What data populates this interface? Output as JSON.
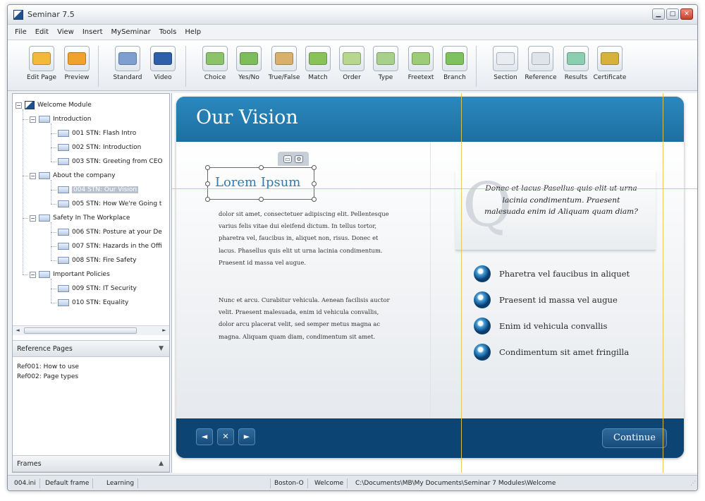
{
  "window": {
    "title": "Seminar 7.5"
  },
  "menu": [
    "File",
    "Edit",
    "View",
    "Insert",
    "MySeminar",
    "Tools",
    "Help"
  ],
  "toolbar": [
    {
      "label": "Edit Page",
      "icon": "edit-page-icon",
      "color": "#f2b93b"
    },
    {
      "label": "Preview",
      "icon": "preview-icon",
      "color": "#f0a32c"
    },
    {
      "label": "Standard",
      "icon": "standard-page-icon",
      "color": "#7f9fd0"
    },
    {
      "label": "Video",
      "icon": "video-icon",
      "color": "#2f5fa8"
    },
    {
      "label": "Choice",
      "icon": "choice-icon",
      "color": "#8cc36a"
    },
    {
      "label": "Yes/No",
      "icon": "yes-no-icon",
      "color": "#7dbd5c"
    },
    {
      "label": "True/False",
      "icon": "true-false-icon",
      "color": "#d9b06b"
    },
    {
      "label": "Match",
      "icon": "match-icon",
      "color": "#8ac25a"
    },
    {
      "label": "Order",
      "icon": "order-icon",
      "color": "#b9d68f"
    },
    {
      "label": "Type",
      "icon": "type-icon",
      "color": "#a9d08a"
    },
    {
      "label": "Freetext",
      "icon": "freetext-icon",
      "color": "#9ccc78"
    },
    {
      "label": "Branch",
      "icon": "branch-icon",
      "color": "#7fc15e"
    },
    {
      "label": "Section",
      "icon": "section-icon",
      "color": "#e9edf1"
    },
    {
      "label": "Reference",
      "icon": "reference-icon",
      "color": "#dfe4ea"
    },
    {
      "label": "Results",
      "icon": "results-icon",
      "color": "#8ccfb0"
    },
    {
      "label": "Certificate",
      "icon": "certificate-icon",
      "color": "#d7b23a"
    }
  ],
  "tree": {
    "root": "Welcome Module",
    "groups": [
      {
        "label": "Introduction",
        "items": [
          "001 STN: Flash Intro",
          "002 STN: Introduction",
          "003 STN: Greeting from CEO"
        ]
      },
      {
        "label": "About the company",
        "items": [
          "004 STN: Our Vision",
          "005 STN: How We're Going t"
        ]
      },
      {
        "label": "Safety In The Workplace",
        "items": [
          "006 STN: Posture at your De",
          "007 STN: Hazards in the Offi",
          "008 STN: Fire Safety"
        ]
      },
      {
        "label": "Important Policies",
        "items": [
          "009 STN: IT Security",
          "010 STN: Equality"
        ]
      }
    ],
    "selected": "004 STN: Our Vision"
  },
  "reference_pages": {
    "header": "Reference Pages",
    "items": [
      "Ref001: How to use",
      "Ref002: Page types"
    ]
  },
  "frames": {
    "header": "Frames"
  },
  "slide": {
    "title": "Our Vision",
    "heading": "Lorem Ipsum",
    "paragraph1": "dolor sit amet, consectetuer adipiscing elit. Pellentesque varius felis vitae dui eleifend dictum. In tellus tortor, pharetra vel, faucibus in, aliquet non, risus. Donec et lacus. Phasellus quis elit ut urna lacinia condimentum. Praesent id massa vel augue.",
    "paragraph2": "Nunc et arcu. Curabitur vehicula. Aenean facilisis auctor velit. Praesent malesuada, enim id vehicula convallis, dolor arcu placerat velit, sed semper metus magna ac magna. Aliquam quam diam, condimentum sit amet.",
    "quote": "Donec et lacus Pasellus quis elit ut urna lacinia condimentum. Praesent malesuada enim id Aliquam quam diam?",
    "quote_mark": "Q",
    "bullets": [
      "Pharetra vel faucibus in aliquet",
      "Praesent id massa vel augue",
      "Enim id vehicula convallis",
      "Condimentum sit amet fringilla"
    ],
    "nav": {
      "prev": "◄",
      "close": "✕",
      "next": "►"
    },
    "continue_label": "Continue"
  },
  "status": [
    "004.ini",
    "Default frame",
    "Learning",
    "Boston-O",
    "Welcome",
    "C:\\Documents\\MB\\My Documents\\Seminar 7 Modules\\Welcome"
  ]
}
